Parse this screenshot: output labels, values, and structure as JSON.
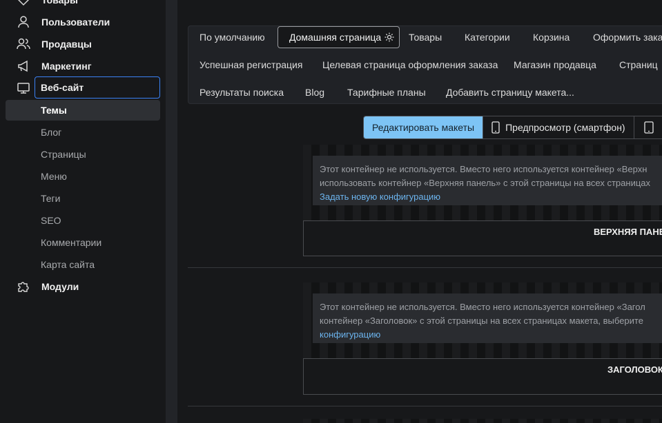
{
  "sidebar": {
    "top_item": "Товары",
    "items": [
      {
        "label": "Пользователи",
        "icon": "user-icon"
      },
      {
        "label": "Продавцы",
        "icon": "users-icon"
      },
      {
        "label": "Маркетинг",
        "icon": "megaphone-icon"
      },
      {
        "label": "Веб-сайт",
        "icon": "monitor-icon"
      }
    ],
    "subitems": [
      "Темы",
      "Блог",
      "Страницы",
      "Меню",
      "Теги",
      "SEO",
      "Комментарии",
      "Карта сайта"
    ],
    "modules": {
      "label": "Модули",
      "icon": "puzzle-icon"
    }
  },
  "tabs": {
    "row1": [
      "По умолчанию",
      "Домашняя страница",
      "Товары",
      "Категории",
      "Корзина",
      "Оформить заказ"
    ],
    "row2": [
      "Успешная регистрация",
      "Целевая страница оформления заказа",
      "Магазин продавца",
      "Страниц"
    ],
    "row3": [
      "Результаты поиска",
      "Blog",
      "Тарифные планы",
      "Добавить страницу макета..."
    ]
  },
  "toggle": {
    "edit": "Редактировать макеты",
    "preview_phone": "Предпросмотр (смартфон)"
  },
  "containers": [
    {
      "notice_line1": "Этот контейнер не используется. Вместо него используется контейнер «Верхн",
      "notice_line2": "использовать контейнер «Верхняя панель» с этой страницы на всех страницах",
      "link": "Задать новую конфигурацию",
      "title": "ВЕРХНЯЯ ПАНЕ"
    },
    {
      "notice_line1": "Этот контейнер не используется. Вместо него используется контейнер «Загол",
      "notice_line2": "контейнер «Заголовок» с этой страницы на всех страницах макета, выберите",
      "link": "конфигурацию",
      "title": "ЗАГОЛОВОК"
    }
  ],
  "colors": {
    "accent": "#3b82f6",
    "toggle_active": "#7dc4f5",
    "link": "#6cb4ee"
  }
}
